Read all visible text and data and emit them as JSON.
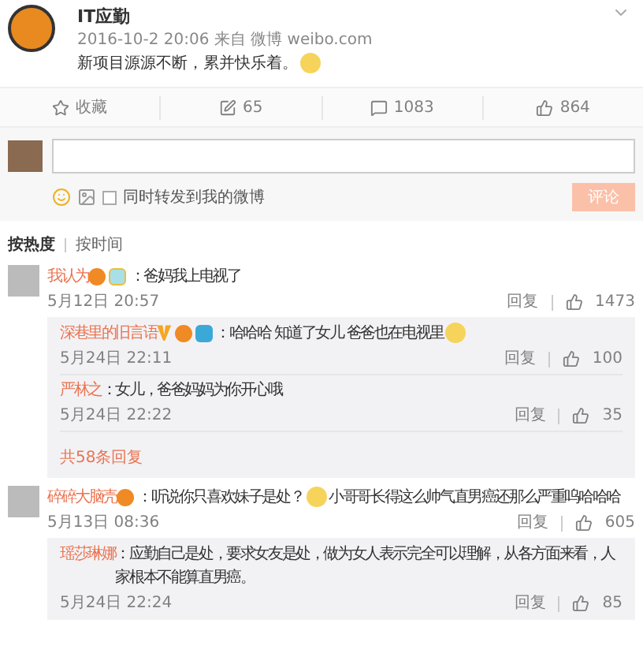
{
  "post": {
    "author": "IT应勤",
    "meta": "2016-10-2 20:06 来自 微博 weibo.com",
    "content": [
      {
        "kind": "text",
        "text": "新项目源源不断，累并快乐着。"
      },
      {
        "kind": "emoji"
      }
    ]
  },
  "actions": [
    {
      "kind": "favorite",
      "label": "收藏"
    },
    {
      "kind": "repost",
      "label": "65"
    },
    {
      "kind": "comment",
      "label": "1083"
    },
    {
      "kind": "like",
      "label": "864"
    }
  ],
  "composer": {
    "repost_label": "同时转发到我的微博",
    "repost_checked": false,
    "submit": "评论",
    "submit_disabled": true
  },
  "sort_tabs": [
    {
      "label": "按热度",
      "selected": true
    },
    {
      "label": "按时间",
      "selected": false
    }
  ],
  "comments": [
    {
      "author": "我认为",
      "content": [
        {
          "kind": "level_badge"
        },
        {
          "kind": "face_badge"
        },
        {
          "kind": "text",
          "text": "：爸妈我上电视了"
        }
      ],
      "time": "5月12日 20:57",
      "reply": "回复",
      "likes": "1473",
      "replies": [
        {
          "author": "深巷里的旧言语",
          "content": [
            {
              "kind": "vip_badge"
            },
            {
              "kind": "level_badge"
            },
            {
              "kind": "camera_badge"
            },
            {
              "kind": "text",
              "text": "：哈哈哈 知道了女儿 爸爸也在电视里"
            },
            {
              "kind": "emoji"
            }
          ],
          "time": "5月24日 22:11",
          "reply": "回复",
          "likes": "100"
        },
        {
          "author": "严林之",
          "content": [
            {
              "kind": "text",
              "text": "：女儿，爸爸妈妈为你开心哦"
            }
          ],
          "time": "5月24日 22:22",
          "reply": "回复",
          "likes": "35"
        }
      ],
      "more": "共58条回复"
    },
    {
      "author": "碎碎大脑壳",
      "content": [
        {
          "kind": "level_badge"
        },
        {
          "kind": "text",
          "text": "：听说你只喜欢妹子是处？"
        },
        {
          "kind": "emoji"
        },
        {
          "kind": "text",
          "text": "小哥哥长得这么帅气直男癌还那么严重呜哈哈哈"
        }
      ],
      "time": "5月13日 08:36",
      "reply": "回复",
      "likes": "605",
      "replies": [
        {
          "author": "瑶莎琳娜",
          "content": [
            {
              "kind": "text",
              "text": "：应勤自己是处，要求女友是处，做为女人表示完全可以理解，从各方面来看，人家根本不能算直男癌。"
            }
          ],
          "time": "5月24日 22:24",
          "reply": "回复",
          "likes": "85"
        }
      ]
    }
  ]
}
